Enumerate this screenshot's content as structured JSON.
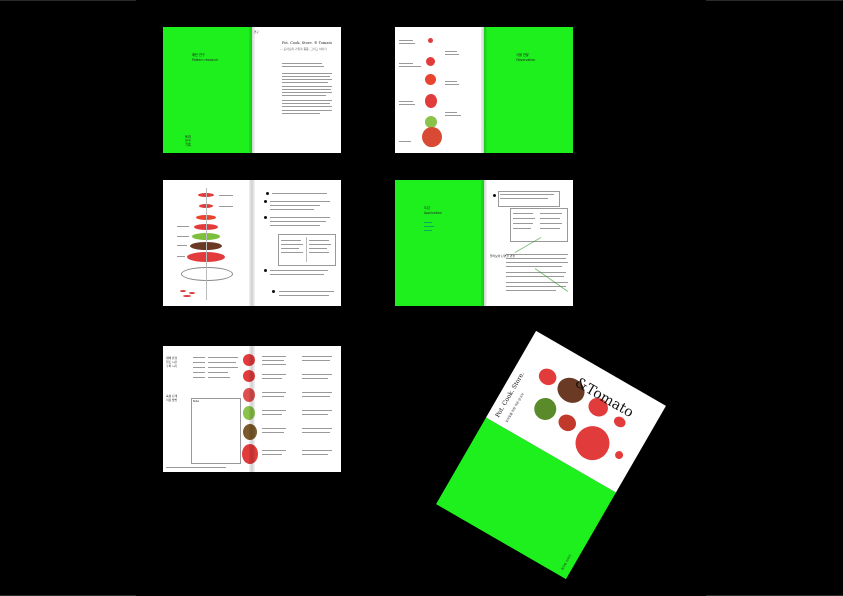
{
  "spread1": {
    "title_kr": "패턴 연구",
    "title_en": "Pattern research",
    "header": "Pot. Cook. Store. ® Tomato",
    "subtitle": "— 토마토의 기원과 품종, 그리고 이야기",
    "side_label": "연구",
    "corner": [
      "토마",
      "연구",
      "기록"
    ]
  },
  "spread2": {
    "right_title_kr": "식물 관찰",
    "right_title_en": "Observation"
  },
  "spread4": {
    "left_title_kr": "도감",
    "left_title_en": "Application",
    "note_kr": "잘라보아 단면을 관찰"
  },
  "spread5": {
    "left_col": [
      "재배 환경",
      "일조 시간",
      "수확 시기"
    ],
    "left_col2": [
      "숙성 단계",
      "저장 방법"
    ],
    "note_label": "Note"
  },
  "cover": {
    "title": "&Tomato",
    "subtitle": "Pot. Cook. Store.",
    "subtitle_kr": "토마토를 위한 작은 안내서",
    "back_text": "토마토 이야기",
    "spine_text": "&Tomato"
  },
  "colors": {
    "accent_green": "#1ef01e",
    "tomato_red": "#e23b3b",
    "tomato_brown": "#6b3a24",
    "background": "#000000"
  }
}
